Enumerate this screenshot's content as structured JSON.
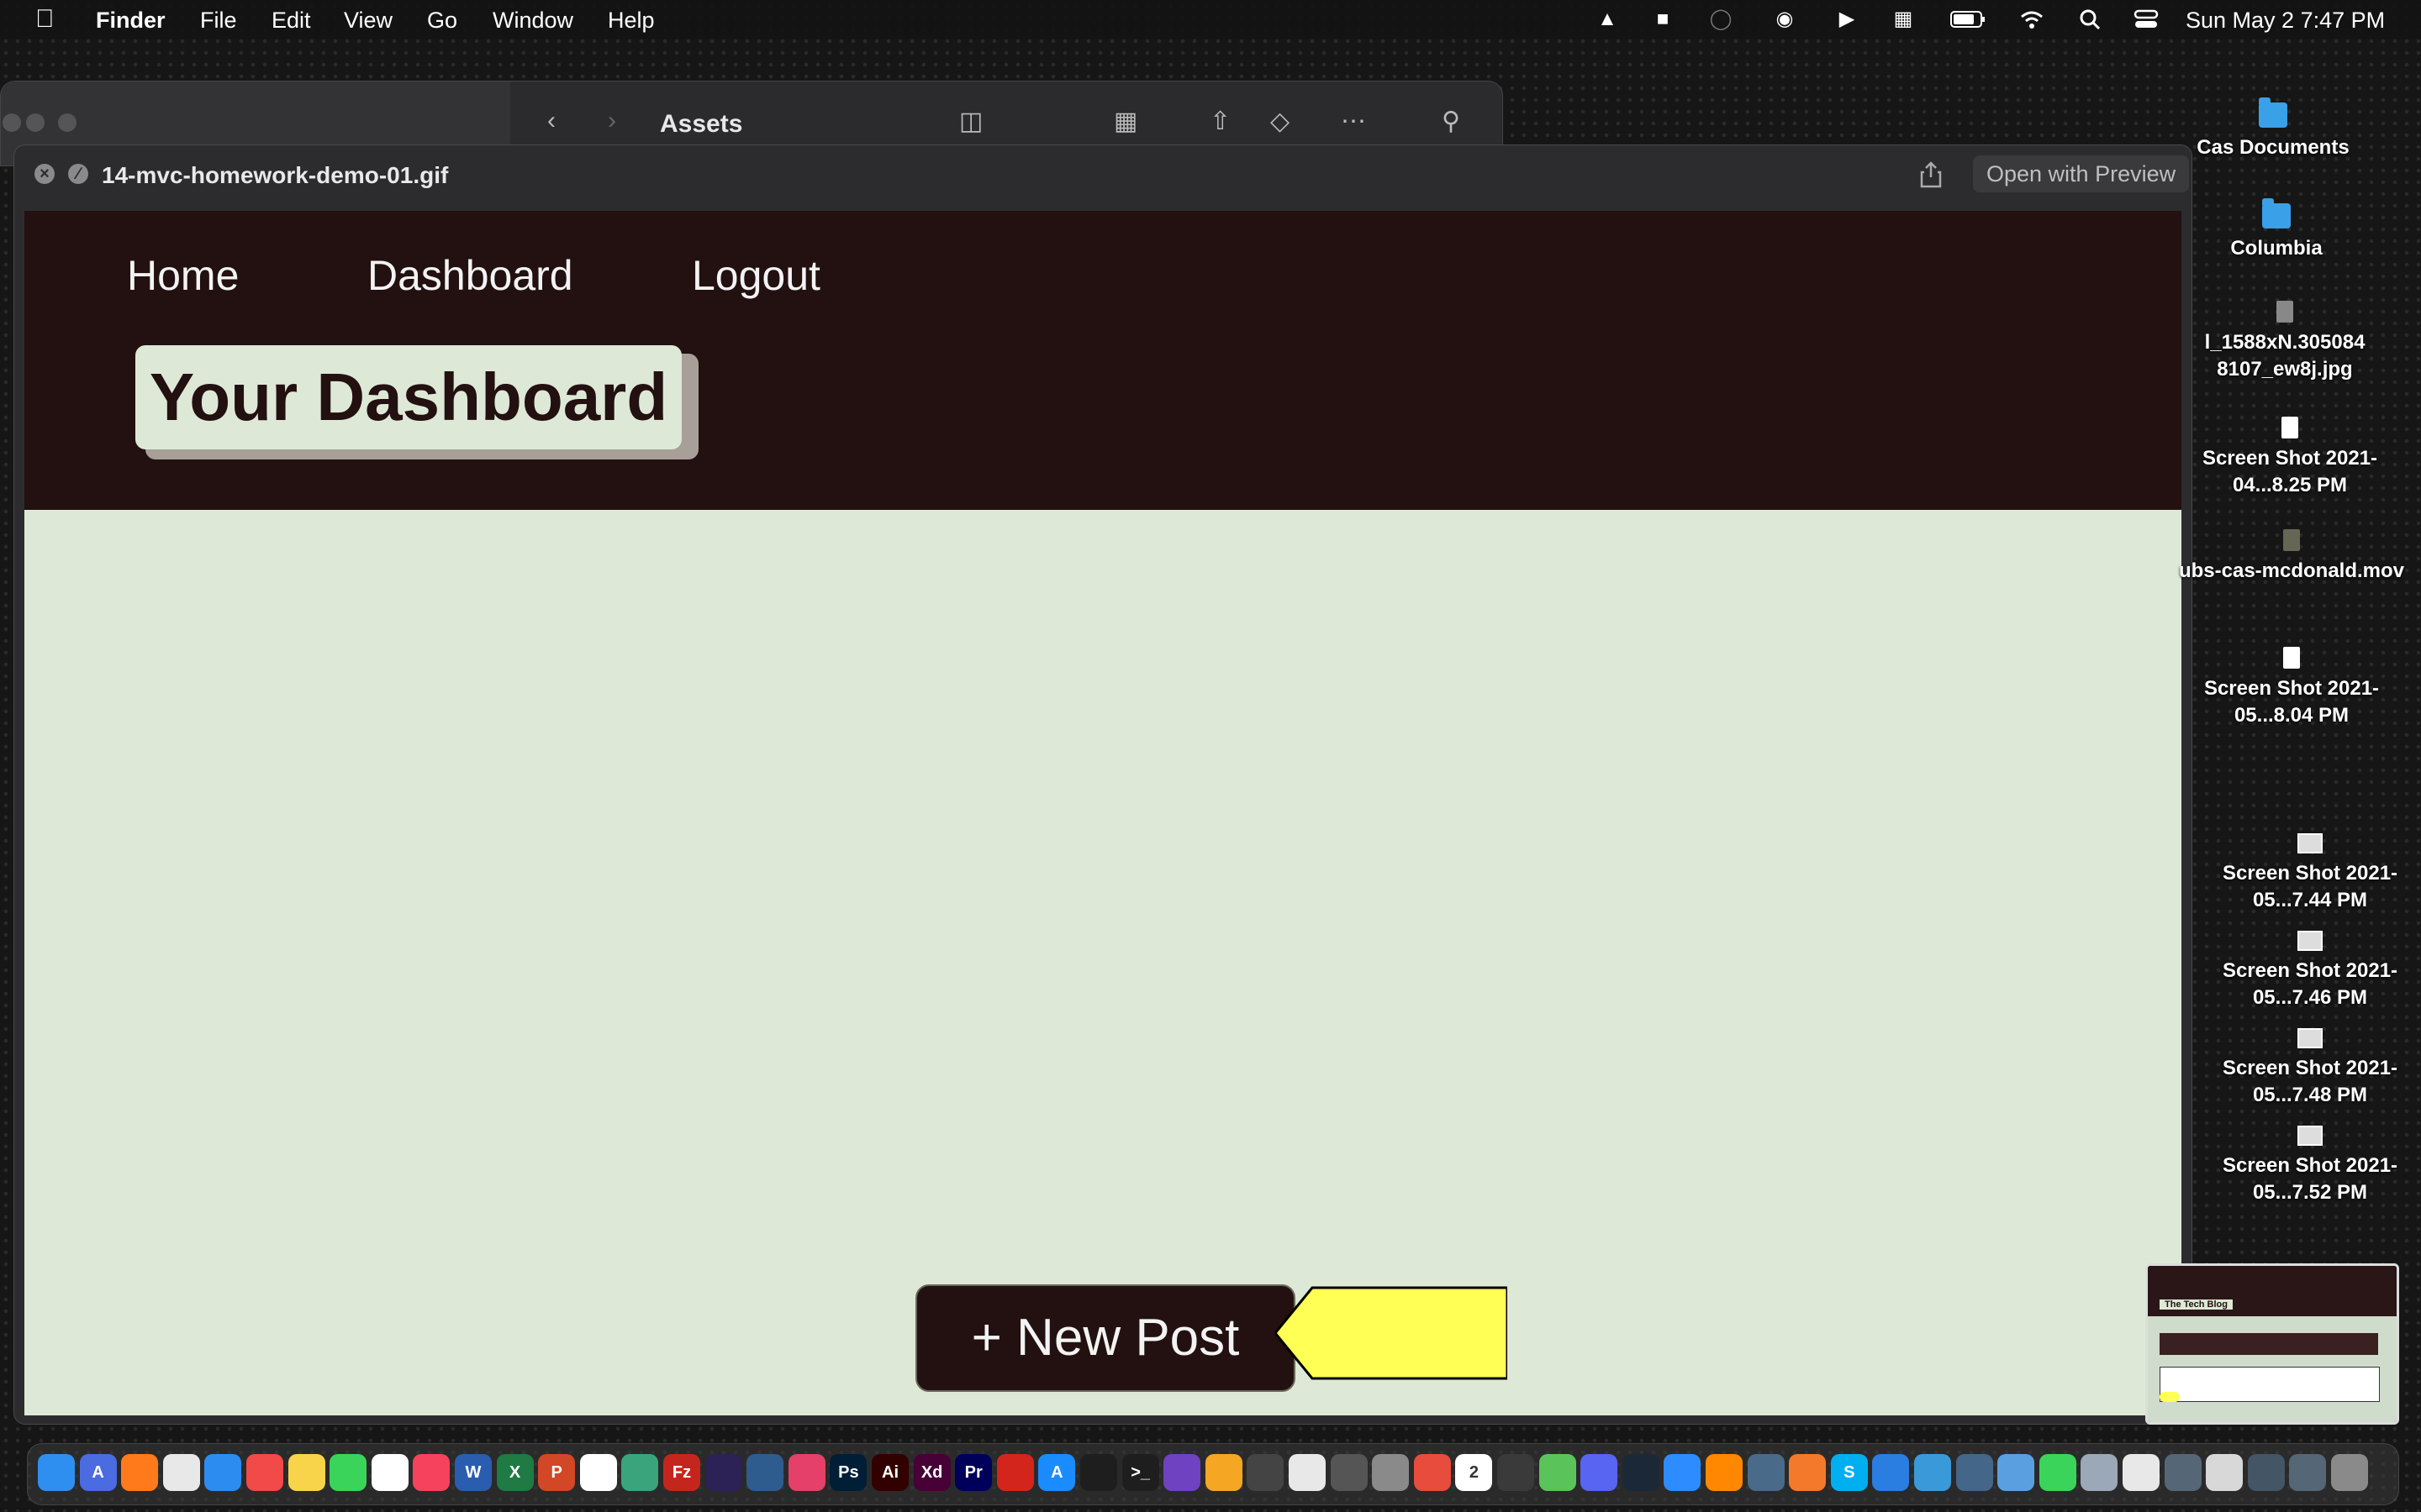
{
  "menubar": {
    "app_name": "Finder",
    "items": [
      "File",
      "Edit",
      "View",
      "Go",
      "Window",
      "Help"
    ],
    "clock": "Sun May 2  7:47 PM"
  },
  "finder": {
    "title": "Assets"
  },
  "quicklook": {
    "filename": "14-mvc-homework-demo-01.gif",
    "open_with": "Open with Preview"
  },
  "site": {
    "nav": [
      "Home",
      "Dashboard",
      "Logout"
    ],
    "title": "Your Dashboard",
    "new_post": "+ New Post",
    "arrow_color": "#ffff55",
    "header_color": "#231011",
    "body_color": "#dde9d6"
  },
  "desktop": [
    {
      "label": "Cas Documents",
      "icon": "folder-icon"
    },
    {
      "label": "Columbia",
      "icon": "folder-icon"
    },
    {
      "label": "l_1588xN.305084 8107_ew8j.jpg",
      "icon": "image-file-icon"
    },
    {
      "label": "Screen Shot 2021-04...8.25 PM",
      "icon": "file-icon"
    },
    {
      "label": "ubs-cas-mcdonald.mov",
      "icon": "video-file-icon"
    },
    {
      "label": "Screen Shot 2021-05...8.04 PM",
      "icon": "file-icon"
    },
    {
      "label": "Screen Shot 2021-05...7.44 PM",
      "icon": "screenshot-icon"
    },
    {
      "label": "Screen Shot 2021-05...7.46 PM",
      "icon": "screenshot-icon"
    },
    {
      "label": "Screen Shot 2021-05...7.48 PM",
      "icon": "screenshot-icon"
    },
    {
      "label": "Screen Shot 2021-05...7.52 PM",
      "icon": "screenshot-icon"
    }
  ],
  "thumbnail": {
    "title": "The Tech Blog"
  },
  "dock": {
    "apps": [
      {
        "name": "finder-icon",
        "color": "#2e8ff0",
        "glyph": ""
      },
      {
        "name": "launchpad-icon",
        "color": "#4b6be0",
        "glyph": "A"
      },
      {
        "name": "firefox-icon",
        "color": "#ff7a1a",
        "glyph": ""
      },
      {
        "name": "chrome-icon",
        "color": "#e8e8e8",
        "glyph": ""
      },
      {
        "name": "safari-icon",
        "color": "#2d8cf0",
        "glyph": ""
      },
      {
        "name": "news-icon",
        "color": "#f24949",
        "glyph": ""
      },
      {
        "name": "notes-icon",
        "color": "#f7d44a",
        "glyph": ""
      },
      {
        "name": "messages-icon",
        "color": "#3bd45a",
        "glyph": ""
      },
      {
        "name": "slack-icon",
        "color": "#ffffff",
        "glyph": ""
      },
      {
        "name": "music-icon",
        "color": "#f6425c",
        "glyph": ""
      },
      {
        "name": "word-icon",
        "color": "#2a5db0",
        "glyph": "W"
      },
      {
        "name": "excel-icon",
        "color": "#1f7a44",
        "glyph": "X"
      },
      {
        "name": "powerpoint-icon",
        "color": "#d24726",
        "glyph": "P"
      },
      {
        "name": "tableau-icon",
        "color": "#ffffff",
        "glyph": ""
      },
      {
        "name": "chatgpt-icon",
        "color": "#3aa57c",
        "glyph": ""
      },
      {
        "name": "filezilla-icon",
        "color": "#c4261d",
        "glyph": "Fz"
      },
      {
        "name": "eclipse-icon",
        "color": "#2c2255",
        "glyph": ""
      },
      {
        "name": "mysql-workbench-icon",
        "color": "#2f5c8f",
        "glyph": ""
      },
      {
        "name": "creative-cloud-icon",
        "color": "#e4406a",
        "glyph": ""
      },
      {
        "name": "photoshop-icon",
        "color": "#001e36",
        "glyph": "Ps"
      },
      {
        "name": "illustrator-icon",
        "color": "#330000",
        "glyph": "Ai"
      },
      {
        "name": "xd-icon",
        "color": "#470137",
        "glyph": "Xd"
      },
      {
        "name": "premiere-icon",
        "color": "#00005b",
        "glyph": "Pr"
      },
      {
        "name": "acrobat-icon",
        "color": "#d3251c",
        "glyph": ""
      },
      {
        "name": "app-store-icon",
        "color": "#1a8cff",
        "glyph": "A"
      },
      {
        "name": "activity-monitor-icon",
        "color": "#1e1e1e",
        "glyph": ""
      },
      {
        "name": "terminal-icon",
        "color": "#1e1e1e",
        "glyph": ">_"
      },
      {
        "name": "visual-studio-icon",
        "color": "#6f42c1",
        "glyph": ""
      },
      {
        "name": "photos-icon",
        "color": "#f5a623",
        "glyph": ""
      },
      {
        "name": "mosaic-icon",
        "color": "#444444",
        "glyph": ""
      },
      {
        "name": "unity-icon",
        "color": "#e8e8e8",
        "glyph": ""
      },
      {
        "name": "chess-icon",
        "color": "#555555",
        "glyph": ""
      },
      {
        "name": "system-prefs-icon",
        "color": "#8a8a8a",
        "glyph": ""
      },
      {
        "name": "reminders-icon",
        "color": "#e74c3c",
        "glyph": ""
      },
      {
        "name": "calendar-icon",
        "color": "#ffffff",
        "glyph": "2"
      },
      {
        "name": "calculator-icon",
        "color": "#3a3a3a",
        "glyph": ""
      },
      {
        "name": "maps-icon",
        "color": "#5ac45a",
        "glyph": ""
      },
      {
        "name": "discord-icon",
        "color": "#5865f2",
        "glyph": ""
      },
      {
        "name": "steam-icon",
        "color": "#1b2838",
        "glyph": ""
      },
      {
        "name": "zoom-icon",
        "color": "#2d8cff",
        "glyph": ""
      },
      {
        "name": "vlc-icon",
        "color": "#ff8800",
        "glyph": ""
      },
      {
        "name": "quicktime-icon",
        "color": "#4a6a8a",
        "glyph": ""
      },
      {
        "name": "blender-icon",
        "color": "#f5792a",
        "glyph": ""
      },
      {
        "name": "skype-icon",
        "color": "#00aff0",
        "glyph": "S"
      },
      {
        "name": "creative-cloud-desktop-icon",
        "color": "#2a7de1",
        "glyph": ""
      },
      {
        "name": "netnewswire-icon",
        "color": "#3a9ad9",
        "glyph": ""
      },
      {
        "name": "zoom-meeting-icon",
        "color": "#446688",
        "glyph": ""
      },
      {
        "name": "screen-icon",
        "color": "#5aa0e0",
        "glyph": ""
      },
      {
        "name": "facetime-icon",
        "color": "#3bd45a",
        "glyph": ""
      },
      {
        "name": "preview-icon",
        "color": "#9aa8b8",
        "glyph": ""
      },
      {
        "name": "textedit-icon",
        "color": "#e8e8e8",
        "glyph": ""
      },
      {
        "name": "downloads-stack-icon",
        "color": "#556677",
        "glyph": ""
      },
      {
        "name": "documents-stack-icon",
        "color": "#d8d8d8",
        "glyph": ""
      },
      {
        "name": "desktop-stack-icon",
        "color": "#445566",
        "glyph": ""
      },
      {
        "name": "recent-stack-icon",
        "color": "#556677",
        "glyph": ""
      },
      {
        "name": "trash-icon",
        "color": "#8a8a8a",
        "glyph": ""
      }
    ]
  }
}
